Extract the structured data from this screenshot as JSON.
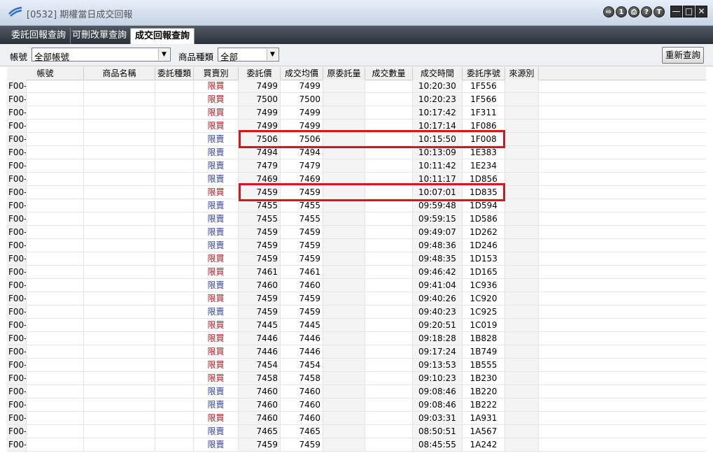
{
  "window": {
    "title": "[0532] 期權當日成交回報",
    "controls": [
      {
        "icon": "exit-icon",
        "glyph": "⇨"
      },
      {
        "icon": "info-icon",
        "glyph": "1"
      },
      {
        "icon": "print-icon",
        "glyph": "⎙"
      },
      {
        "icon": "help-icon",
        "glyph": "?"
      },
      {
        "icon": "pin-icon",
        "glyph": "T"
      }
    ],
    "window_buttons": {
      "minimize": "—",
      "maximize": "□",
      "close": "✕"
    }
  },
  "tabs": [
    {
      "label": "委託回報查詢",
      "active": false
    },
    {
      "label": "可刪改單查詢",
      "active": false
    },
    {
      "label": "成交回報查詢",
      "active": true
    }
  ],
  "filters": {
    "account_label": "帳號",
    "account_value": "全部帳號",
    "product_label": "商品種類",
    "product_value": "全部",
    "refresh_label": "重新查詢"
  },
  "grid": {
    "columns": [
      "帳號",
      "商品名稱",
      "委託種類",
      "買賣別",
      "委託價",
      "成交均價",
      "原委託量",
      "成交數量",
      "成交時間",
      "委託序號",
      "來源別"
    ],
    "rows": [
      {
        "account": "F00-",
        "side": "限買",
        "price": "7499",
        "avg": "7499",
        "time": "10:20:30",
        "seq": "1F556"
      },
      {
        "account": "F00-",
        "side": "限買",
        "price": "7500",
        "avg": "7500",
        "time": "10:20:23",
        "seq": "1F566"
      },
      {
        "account": "F00-",
        "side": "限買",
        "price": "7499",
        "avg": "7499",
        "time": "10:17:42",
        "seq": "1F311"
      },
      {
        "account": "F00-",
        "side": "限買",
        "price": "7499",
        "avg": "7499",
        "time": "10:17:14",
        "seq": "1F086"
      },
      {
        "account": "F00-",
        "side": "限賣",
        "price": "7506",
        "avg": "7506",
        "time": "10:15:50",
        "seq": "1F008"
      },
      {
        "account": "F00-",
        "side": "限賣",
        "price": "7494",
        "avg": "7494",
        "time": "10:13:09",
        "seq": "1E383"
      },
      {
        "account": "F00-",
        "side": "限賣",
        "price": "7479",
        "avg": "7479",
        "time": "10:11:42",
        "seq": "1E234"
      },
      {
        "account": "F00-",
        "side": "限賣",
        "price": "7469",
        "avg": "7469",
        "time": "10:11:17",
        "seq": "1D856"
      },
      {
        "account": "F00-",
        "side": "限買",
        "price": "7459",
        "avg": "7459",
        "time": "10:07:01",
        "seq": "1D835"
      },
      {
        "account": "F00-",
        "side": "限賣",
        "price": "7455",
        "avg": "7455",
        "time": "09:59:48",
        "seq": "1D594"
      },
      {
        "account": "F00-",
        "side": "限賣",
        "price": "7455",
        "avg": "7455",
        "time": "09:59:15",
        "seq": "1D586"
      },
      {
        "account": "F00-",
        "side": "限賣",
        "price": "7459",
        "avg": "7459",
        "time": "09:49:07",
        "seq": "1D262"
      },
      {
        "account": "F00-",
        "side": "限賣",
        "price": "7459",
        "avg": "7459",
        "time": "09:48:36",
        "seq": "1D246"
      },
      {
        "account": "F00-",
        "side": "限買",
        "price": "7459",
        "avg": "7459",
        "time": "09:48:35",
        "seq": "1D153"
      },
      {
        "account": "F00-",
        "side": "限買",
        "price": "7461",
        "avg": "7461",
        "time": "09:46:42",
        "seq": "1D165"
      },
      {
        "account": "F00-",
        "side": "限賣",
        "price": "7460",
        "avg": "7460",
        "time": "09:41:04",
        "seq": "1C936"
      },
      {
        "account": "F00-",
        "side": "限買",
        "price": "7459",
        "avg": "7459",
        "time": "09:40:26",
        "seq": "1C920"
      },
      {
        "account": "F00-",
        "side": "限賣",
        "price": "7459",
        "avg": "7459",
        "time": "09:40:23",
        "seq": "1C925"
      },
      {
        "account": "F00-",
        "side": "限買",
        "price": "7445",
        "avg": "7445",
        "time": "09:20:51",
        "seq": "1C019"
      },
      {
        "account": "F00-",
        "side": "限買",
        "price": "7446",
        "avg": "7446",
        "time": "09:18:28",
        "seq": "1B828"
      },
      {
        "account": "F00-",
        "side": "限買",
        "price": "7446",
        "avg": "7446",
        "time": "09:17:24",
        "seq": "1B749"
      },
      {
        "account": "F00-",
        "side": "限買",
        "price": "7454",
        "avg": "7454",
        "time": "09:13:53",
        "seq": "1B555"
      },
      {
        "account": "F00-",
        "side": "限買",
        "price": "7458",
        "avg": "7458",
        "time": "09:10:23",
        "seq": "1B230"
      },
      {
        "account": "F00-",
        "side": "限賣",
        "price": "7460",
        "avg": "7460",
        "time": "09:08:46",
        "seq": "1B220"
      },
      {
        "account": "F00-",
        "side": "限賣",
        "price": "7460",
        "avg": "7460",
        "time": "09:08:46",
        "seq": "1B222"
      },
      {
        "account": "F00-",
        "side": "限買",
        "price": "7460",
        "avg": "7460",
        "time": "09:03:31",
        "seq": "1A931"
      },
      {
        "account": "F00-",
        "side": "限賣",
        "price": "7465",
        "avg": "7465",
        "time": "08:50:51",
        "seq": "1A567"
      },
      {
        "account": "F00-",
        "side": "限賣",
        "price": "7459",
        "avg": "7459",
        "time": "08:45:55",
        "seq": "1A242"
      }
    ],
    "highlighted_rows": [
      4,
      8
    ]
  },
  "colors": {
    "buy_text": "#b3141c",
    "sell_text": "#2d3f9a",
    "highlight_border": "#d8161d"
  }
}
